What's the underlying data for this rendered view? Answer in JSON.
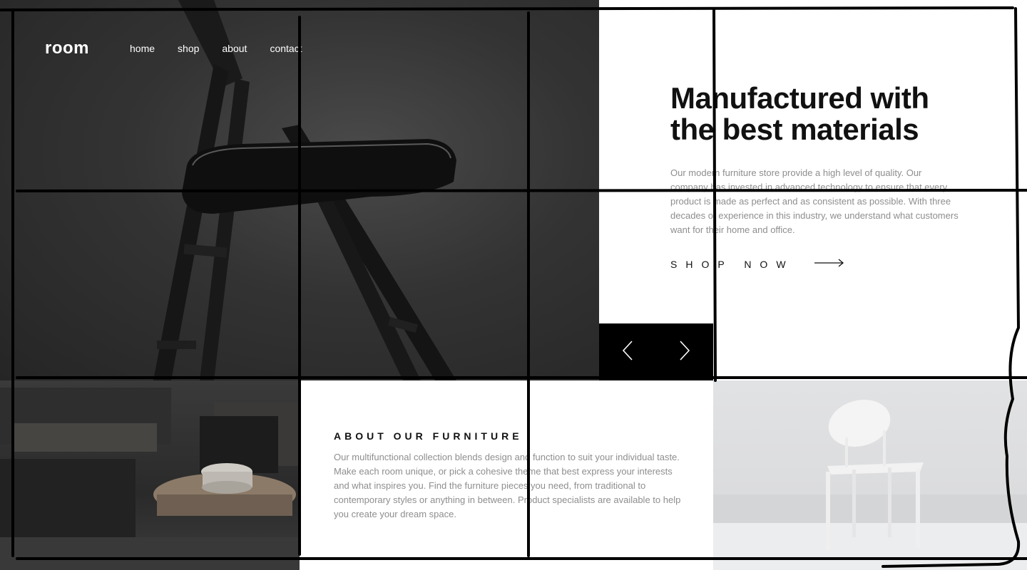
{
  "brand": {
    "logo": "room"
  },
  "nav": {
    "items": [
      "home",
      "shop",
      "about",
      "contact"
    ]
  },
  "hero": {
    "headline": "Manufactured with the best materials",
    "description": "Our modern furniture store provide a high level of quality. Our company has invested in advanced technology to ensure that every product is made as perfect and as consistent as possible. With three decades of experience in this industry, we understand what customers want for their home and office.",
    "cta_label": "SHOP NOW",
    "cta_icon": "arrow-right-icon"
  },
  "slider": {
    "prev_icon": "chevron-left-icon",
    "next_icon": "chevron-right-icon"
  },
  "about": {
    "title": "ABOUT OUR FURNITURE",
    "description": "Our multifunctional collection blends design and function to suit your individual taste. Make each room unique, or pick a cohesive theme that best express your interests and what inspires you. Find the furniture pieces you need, from traditional to contemporary styles or anything in between. Product specialists are available to help you create your dream space."
  },
  "colors": {
    "text_dark": "#111111",
    "text_muted": "#8e8e8e",
    "control_bg": "#000000"
  }
}
